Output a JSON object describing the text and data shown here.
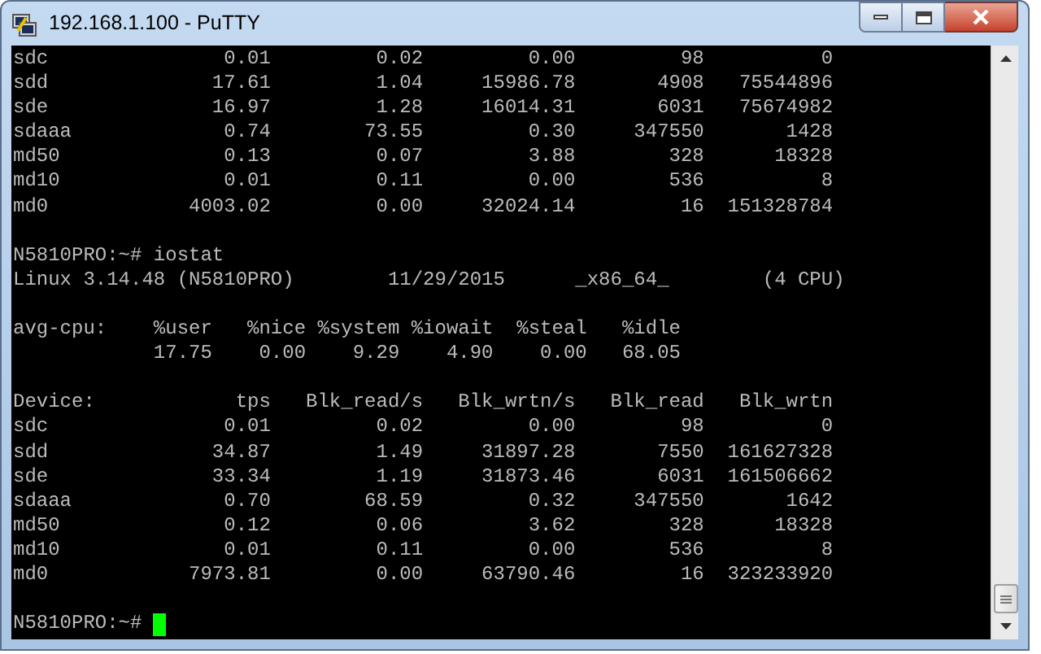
{
  "window": {
    "title": "192.168.1.100 - PuTTY"
  },
  "terminal": {
    "previous_rows": [
      {
        "device": "sdc",
        "tps": "0.01",
        "blk_read_s": "0.02",
        "blk_wrtn_s": "0.00",
        "blk_read": "98",
        "blk_wrtn": "0"
      },
      {
        "device": "sdd",
        "tps": "17.61",
        "blk_read_s": "1.04",
        "blk_wrtn_s": "15986.78",
        "blk_read": "4908",
        "blk_wrtn": "75544896"
      },
      {
        "device": "sde",
        "tps": "16.97",
        "blk_read_s": "1.28",
        "blk_wrtn_s": "16014.31",
        "blk_read": "6031",
        "blk_wrtn": "75674982"
      },
      {
        "device": "sdaaa",
        "tps": "0.74",
        "blk_read_s": "73.55",
        "blk_wrtn_s": "0.30",
        "blk_read": "347550",
        "blk_wrtn": "1428"
      },
      {
        "device": "md50",
        "tps": "0.13",
        "blk_read_s": "0.07",
        "blk_wrtn_s": "3.88",
        "blk_read": "328",
        "blk_wrtn": "18328"
      },
      {
        "device": "md10",
        "tps": "0.01",
        "blk_read_s": "0.11",
        "blk_wrtn_s": "0.00",
        "blk_read": "536",
        "blk_wrtn": "8"
      },
      {
        "device": "md0",
        "tps": "4003.02",
        "blk_read_s": "0.00",
        "blk_wrtn_s": "32024.14",
        "blk_read": "16",
        "blk_wrtn": "151328784"
      }
    ],
    "prompt": "N5810PRO:~#",
    "command": "iostat",
    "system": {
      "kernel": "Linux 3.14.48 (N5810PRO)",
      "date": "11/29/2015",
      "arch": "_x86_64_",
      "cpus": "(4 CPU)"
    },
    "cpu": {
      "label": "avg-cpu:",
      "headers": [
        "%user",
        "%nice",
        "%system",
        "%iowait",
        "%steal",
        "%idle"
      ],
      "values": [
        "17.75",
        "0.00",
        "9.29",
        "4.90",
        "0.00",
        "68.05"
      ]
    },
    "device_headers": [
      "Device:",
      "tps",
      "Blk_read/s",
      "Blk_wrtn/s",
      "Blk_read",
      "Blk_wrtn"
    ],
    "rows": [
      {
        "device": "sdc",
        "tps": "0.01",
        "blk_read_s": "0.02",
        "blk_wrtn_s": "0.00",
        "blk_read": "98",
        "blk_wrtn": "0"
      },
      {
        "device": "sdd",
        "tps": "34.87",
        "blk_read_s": "1.49",
        "blk_wrtn_s": "31897.28",
        "blk_read": "7550",
        "blk_wrtn": "161627328"
      },
      {
        "device": "sde",
        "tps": "33.34",
        "blk_read_s": "1.19",
        "blk_wrtn_s": "31873.46",
        "blk_read": "6031",
        "blk_wrtn": "161506662"
      },
      {
        "device": "sdaaa",
        "tps": "0.70",
        "blk_read_s": "68.59",
        "blk_wrtn_s": "0.32",
        "blk_read": "347550",
        "blk_wrtn": "1642"
      },
      {
        "device": "md50",
        "tps": "0.12",
        "blk_read_s": "0.06",
        "blk_wrtn_s": "3.62",
        "blk_read": "328",
        "blk_wrtn": "18328"
      },
      {
        "device": "md10",
        "tps": "0.01",
        "blk_read_s": "0.11",
        "blk_wrtn_s": "0.00",
        "blk_read": "536",
        "blk_wrtn": "8"
      },
      {
        "device": "md0",
        "tps": "7973.81",
        "blk_read_s": "0.00",
        "blk_wrtn_s": "63790.46",
        "blk_read": "16",
        "blk_wrtn": "323233920"
      }
    ],
    "final_prompt": "N5810PRO:~#"
  }
}
